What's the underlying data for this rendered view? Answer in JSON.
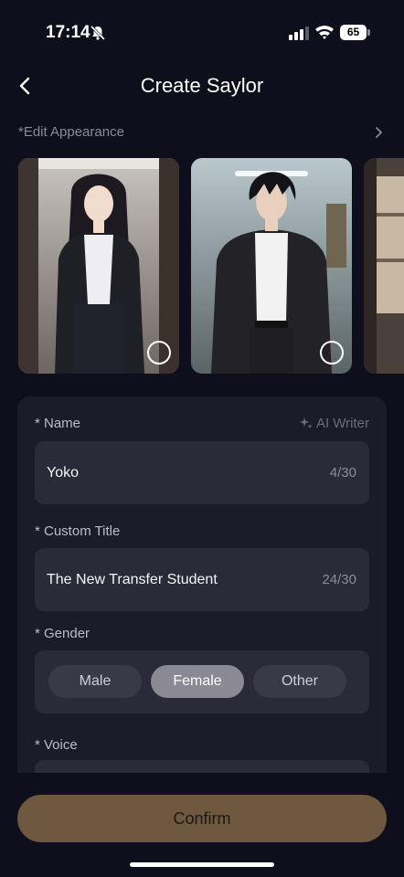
{
  "status_bar": {
    "time": "17:14",
    "battery": "65"
  },
  "header": {
    "title": "Create Saylor"
  },
  "appearance": {
    "label": "*Edit Appearance"
  },
  "form": {
    "name": {
      "label": "* Name",
      "value": "Yoko",
      "count": "4/30"
    },
    "ai_writer": "AI Writer",
    "custom_title": {
      "label": "* Custom Title",
      "value": "The New Transfer Student",
      "count": "24/30"
    },
    "gender": {
      "label": "* Gender",
      "options": [
        "Male",
        "Female",
        "Other"
      ],
      "selected": "Female"
    },
    "voice": {
      "label": "* Voice"
    }
  },
  "confirm_label": "Confirm",
  "colors": {
    "background": "#0f0e1c",
    "panel": "#1c1b28",
    "field": "#2b2a38",
    "confirm": "#6e5940",
    "selected_pill": "#8a8994"
  }
}
